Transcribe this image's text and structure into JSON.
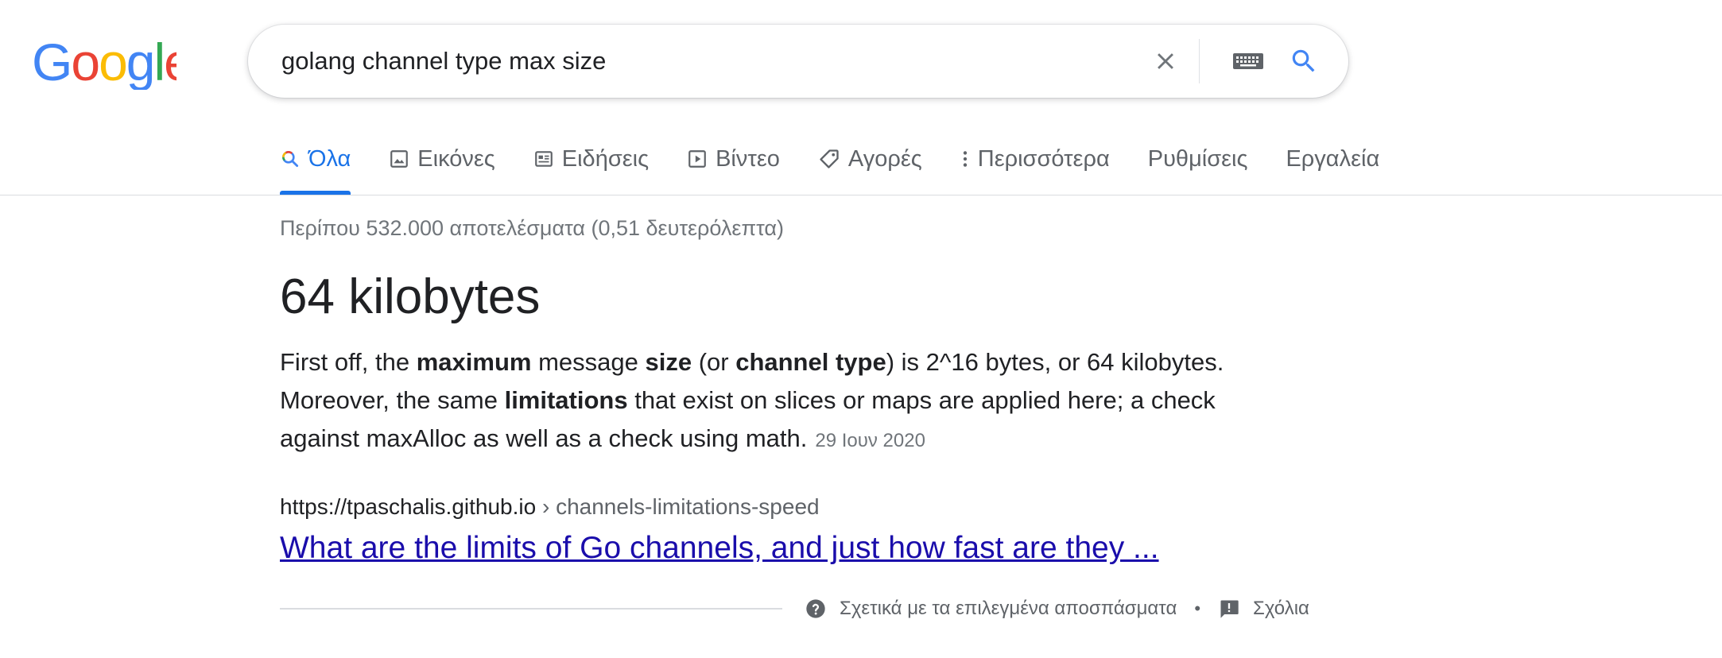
{
  "logo": {
    "letters": [
      "G",
      "o",
      "o",
      "g",
      "l",
      "e"
    ],
    "colors": [
      "#4285F4",
      "#EA4335",
      "#FBBC05",
      "#4285F4",
      "#34A853",
      "#EA4335"
    ]
  },
  "search": {
    "query": "golang channel type max size",
    "icons": {
      "clear": "close-icon",
      "keyboard": "keyboard-icon",
      "submit": "search-icon"
    },
    "accent": "#4285F4"
  },
  "tabs": [
    {
      "label": "Όλα",
      "icon": "search-icon",
      "active": true
    },
    {
      "label": "Εικόνες",
      "icon": "image-icon",
      "active": false
    },
    {
      "label": "Ειδήσεις",
      "icon": "news-icon",
      "active": false
    },
    {
      "label": "Βίντεο",
      "icon": "video-icon",
      "active": false
    },
    {
      "label": "Αγορές",
      "icon": "tag-icon",
      "active": false
    },
    {
      "label": "Περισσότερα",
      "icon": "more-vert-icon",
      "active": false
    },
    {
      "label": "Ρυθμίσεις",
      "icon": "",
      "active": false
    },
    {
      "label": "Εργαλεία",
      "icon": "",
      "active": false
    }
  ],
  "stats": "Περίπου 532.000 αποτελέσματα (0,51 δευτερόλεπτα)",
  "featured": {
    "answer": "64 kilobytes",
    "snippet": {
      "p1": "First off, the ",
      "b1": "maximum",
      "p2": " message ",
      "b2": "size",
      "p3": " (or ",
      "b3": "channel type",
      "p4": ") is 2^16 bytes, or 64 kilobytes. Moreover, the same ",
      "b4": "limitations",
      "p5": " that exist on slices or maps are applied here; a check against maxAlloc as well as a check using math."
    },
    "date": "29 Ιουν 2020",
    "cite_domain": "https://tpaschalis.github.io",
    "cite_path": " › channels-limitations-speed",
    "title": "What are the limits of Go channels, and just how fast are they ...",
    "link_color": "#1a0dab"
  },
  "footer": {
    "about": "Σχετικά με τα επιλεγμένα αποσπάσματα",
    "separator": "•",
    "feedback": "Σχόλια",
    "icons": {
      "about": "help-icon",
      "feedback": "feedback-icon"
    }
  }
}
